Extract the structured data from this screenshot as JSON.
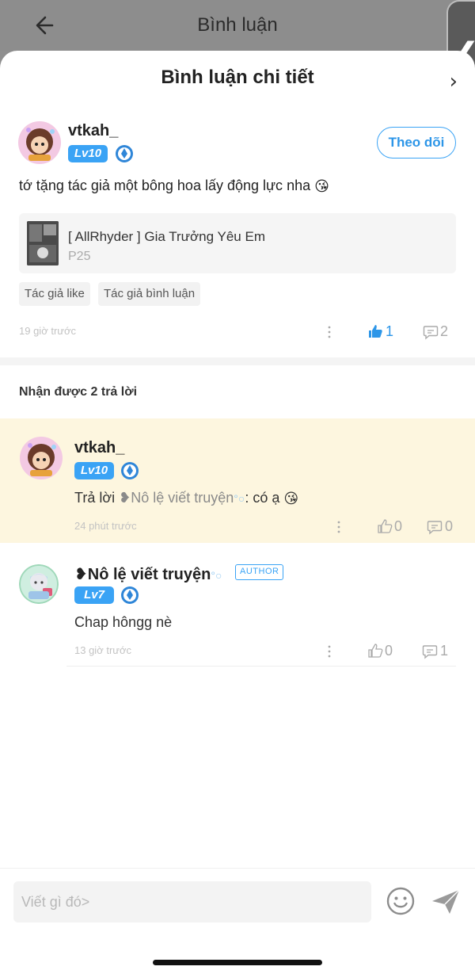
{
  "underlying_header": {
    "title": "Bình luận"
  },
  "sheet": {
    "title": "Bình luận chi tiết",
    "close_glyph": "›"
  },
  "side_tab": {
    "glyph": "❮"
  },
  "comment": {
    "user": "vtkah_",
    "level": "Lv10",
    "follow_label": "Theo dõi",
    "text": "tớ tặng tác giả một bông hoa lấy động lực nha",
    "emoji": "😘",
    "story": {
      "title": "[ AllRhyder ] Gia Trưởng Yêu Em",
      "chapter": "P25"
    },
    "tags": [
      "Tác giả like",
      "Tác giả bình luận"
    ],
    "time": "19 giờ trước",
    "likes": "1",
    "replies": "2"
  },
  "replies_header": "Nhận được 2 trả lời",
  "replies": [
    {
      "user": "vtkah_",
      "level": "Lv10",
      "prefix": "Trả lời ",
      "mention": "❥Nô lệ viết truyện",
      "mention_bubble": "°○",
      "suffix": ": có ạ",
      "emoji": "😘",
      "time": "24 phút trước",
      "likes": "0",
      "comments": "0"
    },
    {
      "user": "❥Nô lệ viết truyện",
      "user_bubble": "°○",
      "badge": "AUTHOR",
      "level": "Lv7",
      "text": "Chap hôngg nè",
      "time": "13 giờ trước",
      "likes": "0",
      "comments": "1"
    }
  ],
  "composer": {
    "placeholder": "Viết gì đó>"
  },
  "colors": {
    "accent": "#3aa3f5",
    "reply_highlight": "#fdf6df",
    "like_active": "#2d96e8"
  },
  "icons": [
    "back-arrow-icon",
    "vip-gem-icon",
    "more-icon",
    "thumbs-up-icon",
    "comment-icon",
    "emoji-icon",
    "send-icon"
  ]
}
